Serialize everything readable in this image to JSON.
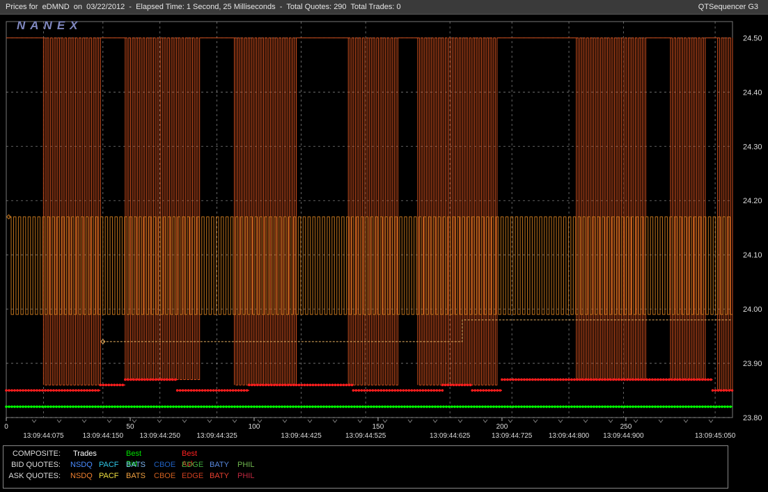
{
  "window": {
    "title": "Prices for  eDMND  on  03/22/2012  -  Elapsed Time: 1 Second, 25 Milliseconds  -  Total Quotes: 290  Total Trades: 0",
    "app_name": "QTSequencer G3"
  },
  "watermark": "NANEX",
  "colors": {
    "background": "#000000",
    "grid": "#b4b4b4",
    "bid_quote_line": "#c8781e",
    "ask_quote_line": "#d2501e",
    "best_bid": "#00ff00",
    "best_ask": "#ff1e1e",
    "trades": "#ffffff"
  },
  "chart_data": {
    "type": "line",
    "x_label": "",
    "y_label": "",
    "x_ticks": [
      "0",
      "50",
      "100",
      "150",
      "200",
      "250"
    ],
    "x_tick_values": [
      0,
      50,
      100,
      150,
      200,
      250
    ],
    "y_ticks": [
      "24.50",
      "24.40",
      "24.30",
      "24.20",
      "24.10",
      "24.00",
      "23.90",
      "23.80"
    ],
    "ylim": [
      23.8,
      24.53
    ],
    "xlim": [
      0,
      293
    ],
    "time_labels": [
      {
        "label": "13:09:44:075",
        "x": 15
      },
      {
        "label": "13:09:44:150",
        "x": 39
      },
      {
        "label": "13:09:44:250",
        "x": 62
      },
      {
        "label": "13:09:44:325",
        "x": 85
      },
      {
        "label": "13:09:44:425",
        "x": 119
      },
      {
        "label": "13:09:44:525",
        "x": 145
      },
      {
        "label": "13:09:44:625",
        "x": 179
      },
      {
        "label": "13:09:44:725",
        "x": 204
      },
      {
        "label": "13:09:44:800",
        "x": 227
      },
      {
        "label": "13:09:44:900",
        "x": 249
      },
      {
        "label": "13:09:45:050",
        "x": 286
      }
    ],
    "grid": true,
    "series": [
      {
        "name": "BATY",
        "kind": "ask",
        "level_values": [
          23.86,
          24.5
        ],
        "segments": [
          {
            "start": 0,
            "end": 15,
            "level": 24.5
          },
          {
            "start": 15,
            "end": 38,
            "level": 23.86
          },
          {
            "start": 38,
            "end": 48,
            "level": 24.5
          },
          {
            "start": 48,
            "end": 78,
            "level": 23.87
          },
          {
            "start": 78,
            "end": 92,
            "level": 24.5
          },
          {
            "start": 92,
            "end": 117,
            "level": 23.86
          },
          {
            "start": 117,
            "end": 138,
            "level": 24.5
          },
          {
            "start": 138,
            "end": 158,
            "level": 23.86
          },
          {
            "start": 158,
            "end": 166,
            "level": 24.5
          },
          {
            "start": 166,
            "end": 198,
            "level": 23.86
          },
          {
            "start": 198,
            "end": 230,
            "level": 24.5
          },
          {
            "start": 230,
            "end": 258,
            "level": 23.87
          },
          {
            "start": 258,
            "end": 268,
            "level": 24.5
          },
          {
            "start": 268,
            "end": 282,
            "level": 23.87
          },
          {
            "start": 282,
            "end": 287,
            "level": 24.5
          },
          {
            "start": 287,
            "end": 293,
            "level": 23.85
          }
        ],
        "flicker_level_low": 23.85
      },
      {
        "name": "BATS",
        "kind": "bid",
        "level_values": [
          23.99,
          24.17
        ],
        "start_x": 1,
        "start_y": 24.17,
        "segments": [
          {
            "start": 1,
            "end": 5,
            "level": 23.99
          },
          {
            "start": 5,
            "end": 17,
            "level": 24.17
          },
          {
            "start": 17,
            "end": 36,
            "level": 23.99
          },
          {
            "start": 36,
            "end": 48,
            "level": 24.17
          },
          {
            "start": 48,
            "end": 57,
            "level": 23.99
          },
          {
            "start": 57,
            "end": 79,
            "level": 24.17
          },
          {
            "start": 79,
            "end": 88,
            "level": 23.99
          },
          {
            "start": 88,
            "end": 105,
            "level": 24.17
          },
          {
            "start": 105,
            "end": 117,
            "level": 23.99
          },
          {
            "start": 117,
            "end": 128,
            "level": 24.17
          },
          {
            "start": 128,
            "end": 150,
            "level": 23.99
          },
          {
            "start": 150,
            "end": 168,
            "level": 24.17
          },
          {
            "start": 168,
            "end": 188,
            "level": 23.99
          },
          {
            "start": 188,
            "end": 210,
            "level": 24.17
          },
          {
            "start": 210,
            "end": 229,
            "level": 23.99
          },
          {
            "start": 229,
            "end": 247,
            "level": 24.17
          },
          {
            "start": 247,
            "end": 268,
            "level": 23.99
          },
          {
            "start": 268,
            "end": 293,
            "level": 24.17
          }
        ]
      },
      {
        "name": "EDGE",
        "kind": "bid",
        "points": [
          [
            39,
            23.94
          ],
          [
            184,
            23.94
          ],
          [
            184,
            23.98
          ],
          [
            293,
            23.98
          ]
        ]
      },
      {
        "name": "Best Ask",
        "kind": "composite",
        "step": [
          {
            "start": 0,
            "end": 38,
            "level": 23.85
          },
          {
            "start": 38,
            "end": 48,
            "level": 23.86
          },
          {
            "start": 48,
            "end": 69,
            "level": 23.87
          },
          {
            "start": 69,
            "end": 98,
            "level": 23.85
          },
          {
            "start": 98,
            "end": 117,
            "level": 23.86
          },
          {
            "start": 117,
            "end": 140,
            "level": 23.86
          },
          {
            "start": 140,
            "end": 176,
            "level": 23.85
          },
          {
            "start": 176,
            "end": 188,
            "level": 23.86
          },
          {
            "start": 188,
            "end": 200,
            "level": 23.85
          },
          {
            "start": 200,
            "end": 285,
            "level": 23.87
          },
          {
            "start": 285,
            "end": 293,
            "level": 23.85
          }
        ]
      },
      {
        "name": "Best Bid",
        "kind": "composite",
        "level": 23.82
      }
    ]
  },
  "legend": {
    "composite": {
      "heading": "COMPOSITE:",
      "items": [
        {
          "label": "Trades",
          "color": "#ffffff"
        },
        {
          "label": "Best Bid",
          "color": "#00e000"
        },
        {
          "label": "Best Ask",
          "color": "#ff2020"
        }
      ]
    },
    "bid_quotes": {
      "heading": "BID QUOTES:",
      "items": [
        {
          "label": "NSDQ",
          "color": "#4a8cff"
        },
        {
          "label": "PACF",
          "color": "#30c8e8"
        },
        {
          "label": "BATS",
          "color": "#7db4f0"
        },
        {
          "label": "CBOE",
          "color": "#2060c0"
        },
        {
          "label": "EDGE",
          "color": "#40b040"
        },
        {
          "label": "BATY",
          "color": "#5a8ae0"
        },
        {
          "label": "PHIL",
          "color": "#70b850"
        }
      ]
    },
    "ask_quotes": {
      "heading": "ASK QUOTES:",
      "items": [
        {
          "label": "NSDQ",
          "color": "#f08030"
        },
        {
          "label": "PACF",
          "color": "#f0e040"
        },
        {
          "label": "BATS",
          "color": "#f0a040"
        },
        {
          "label": "CBOE",
          "color": "#d06020"
        },
        {
          "label": "EDGE",
          "color": "#d04020"
        },
        {
          "label": "BATY",
          "color": "#e84030"
        },
        {
          "label": "PHIL",
          "color": "#c02840"
        }
      ]
    }
  }
}
